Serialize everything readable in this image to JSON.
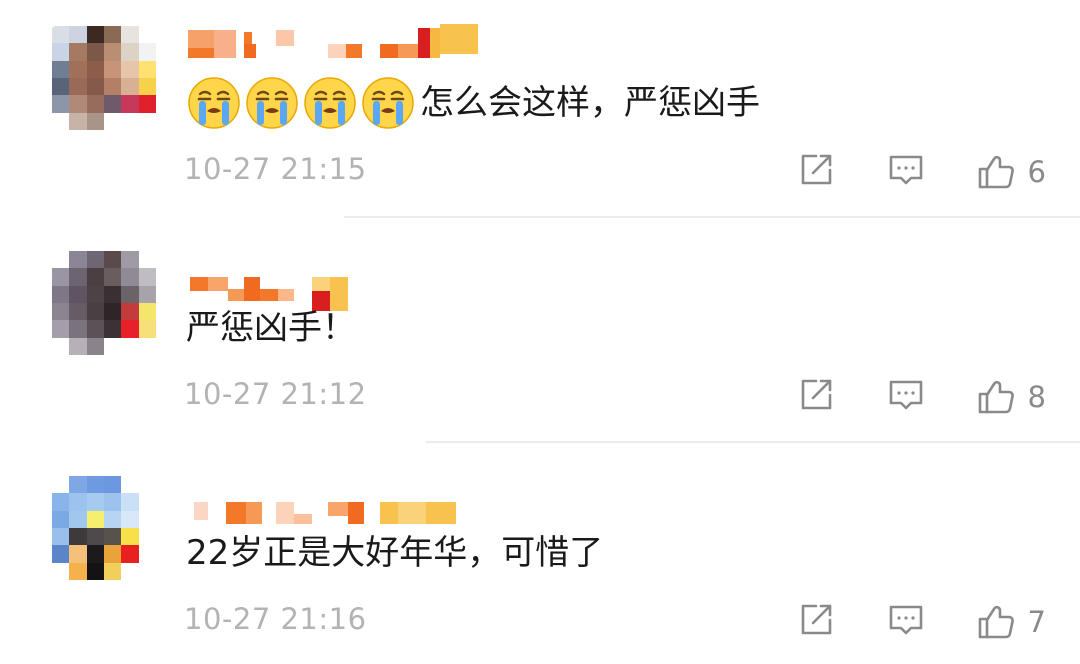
{
  "comments": [
    {
      "text": "怎么会这样，严惩凶手",
      "emoji": "crying-face",
      "emoji_count": 4,
      "time": "10-27 21:15",
      "likes": "6"
    },
    {
      "text": "严惩凶手！",
      "time": "10-27 21:12",
      "likes": "8"
    },
    {
      "text": "22岁正是大好年华，可惜了",
      "time": "10-27 21:16",
      "likes": "7"
    }
  ],
  "icons": {
    "share": "share-icon",
    "reply": "comment-icon",
    "like": "thumbs-up-icon"
  },
  "colors": {
    "text": "#1a1a1a",
    "meta": "#b3b3b3",
    "icon": "#8a8a8a",
    "divider": "#ececec",
    "name_pixel_orange": "#f4782a"
  }
}
